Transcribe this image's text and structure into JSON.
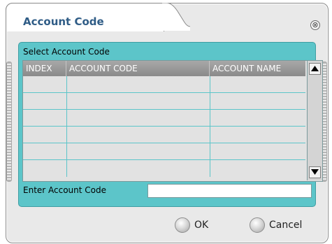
{
  "dialog": {
    "title": "Account Code",
    "close_symbol": "⊗"
  },
  "panel": {
    "caption": "Select Account Code",
    "columns": [
      "INDEX",
      "ACCOUNT CODE",
      "ACCOUNT NAME"
    ],
    "rows": [
      [
        "",
        "",
        ""
      ],
      [
        "",
        "",
        ""
      ],
      [
        "",
        "",
        ""
      ],
      [
        "",
        "",
        ""
      ],
      [
        "",
        "",
        ""
      ],
      [
        "",
        "",
        ""
      ]
    ],
    "entry_label": "Enter Account Code",
    "entry_value": ""
  },
  "buttons": {
    "ok": "OK",
    "cancel": "Cancel"
  },
  "colors": {
    "panel_teal": "#5cc5c9",
    "title_blue": "#2f5c86",
    "header_gray": "#9a9a9a"
  },
  "icons": {
    "close": "close-circle-icon",
    "scroll_up": "scroll-up-arrow-icon",
    "scroll_down": "scroll-down-arrow-icon",
    "ok_orb": "orb-icon",
    "cancel_orb": "orb-icon"
  }
}
